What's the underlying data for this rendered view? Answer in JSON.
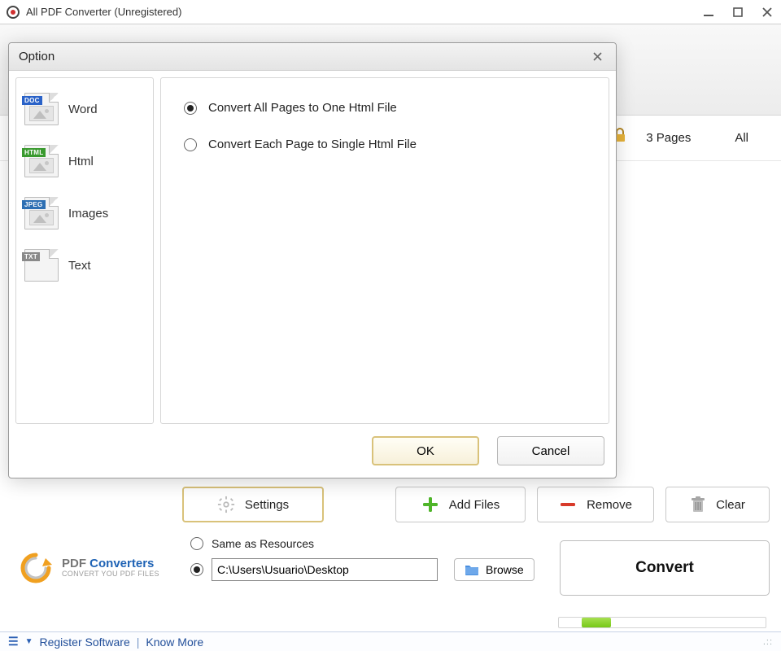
{
  "window": {
    "title": "All PDF Converter (Unregistered)"
  },
  "tabs": {
    "pages": "3 Pages",
    "all": "All"
  },
  "controls": {
    "settings": "Settings",
    "add_files": "Add Files",
    "remove": "Remove",
    "clear": "Clear"
  },
  "destination": {
    "same_as_resources": "Same as Resources",
    "path": "C:\\Users\\Usuario\\Desktop",
    "browse": "Browse"
  },
  "convert_label": "Convert",
  "brand": {
    "line1_plain": "PDF ",
    "line1_bold": "Converters",
    "tagline": "CONVERT YOU PDF FILES"
  },
  "footer": {
    "register": "Register Software",
    "know_more": "Know More"
  },
  "dialog": {
    "title": "Option",
    "side": {
      "word": "Word",
      "html": "Html",
      "images": "Images",
      "text": "Text"
    },
    "options": {
      "all_to_one": "Convert All Pages to One Html File",
      "each_to_single": "Convert Each Page to Single Html File"
    },
    "ok": "OK",
    "cancel": "Cancel"
  }
}
